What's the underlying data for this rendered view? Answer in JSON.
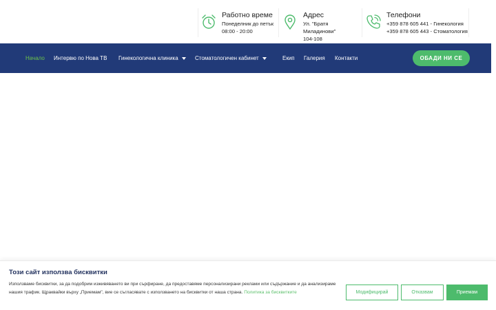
{
  "header": {
    "hours": {
      "icon": "alarm-clock-icon",
      "title": "Работно време",
      "line1": "Понеделник до петък",
      "line2": "08:00 - 20:00"
    },
    "address": {
      "icon": "location-pin-icon",
      "title": "Адрес",
      "line1": "Ул. \"Братя Миладинови\"",
      "line2": "104-108"
    },
    "phones": {
      "icon": "phone-call-icon",
      "title": "Телефони",
      "line1": "+359 878 605 441 - Гинекология",
      "line2": "+359 878 605 443 - Стоматология"
    }
  },
  "nav": {
    "items": [
      {
        "label": "Начало",
        "active": true
      },
      {
        "label": "Интервю по Нова ТВ"
      },
      {
        "label": "Гинекологична клиника",
        "dropdown": true
      },
      {
        "label": "Стоматологичен кабинет",
        "dropdown": true
      },
      {
        "label": "Екип"
      },
      {
        "label": "Галерия"
      },
      {
        "label": "Контакти"
      }
    ],
    "cta": "ОБАДИ НИ СЕ"
  },
  "cookie": {
    "title": "Този сайт използва бисквитки",
    "text": "Използваме бисквитки, за да подобрим изживяването ви при сърфиране, да предоставяме персонализирани реклами или съдържание и да анализираме нашия трафик. Щраквайки върху „Приемам\", вие се съгласявате с използването на бисквитки от наша страна.",
    "policy_link": "Политика за бисквитките",
    "buttons": {
      "modify": "Модифицирай",
      "reject": "Отказвам",
      "accept": "Приемам"
    }
  },
  "colors": {
    "navy": "#213a78",
    "green": "#4dbb6c",
    "active_nav": "#6cc24a"
  }
}
